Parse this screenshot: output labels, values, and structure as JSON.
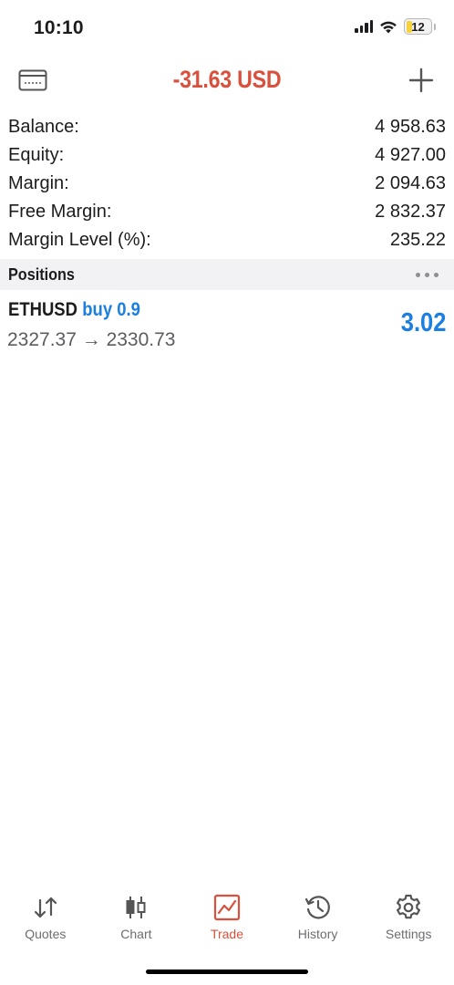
{
  "status_bar": {
    "time": "10:10",
    "battery": "12"
  },
  "header": {
    "title": "-31.63 USD",
    "title_color": "#d9503c",
    "left_icon": "account-card-icon",
    "right_icon": "plus-icon"
  },
  "summary": [
    {
      "label": "Balance:",
      "value": "4 958.63"
    },
    {
      "label": "Equity:",
      "value": "4 927.00"
    },
    {
      "label": "Margin:",
      "value": "2 094.63"
    },
    {
      "label": "Free Margin:",
      "value": "2 832.37"
    },
    {
      "label": "Margin Level (%):",
      "value": "235.22"
    }
  ],
  "positions": {
    "title": "Positions",
    "items": [
      {
        "symbol": "ETHUSD",
        "side": "buy 0.9",
        "prices": "2327.37 → 2330.73",
        "profit": "3.02",
        "profit_color": "#1a7fe0"
      }
    ]
  },
  "tabs": [
    {
      "label": "Quotes",
      "icon": "quotes-arrows-icon",
      "active": false
    },
    {
      "label": "Chart",
      "icon": "candlestick-icon",
      "active": false
    },
    {
      "label": "Trade",
      "icon": "trade-chart-icon",
      "active": true
    },
    {
      "label": "History",
      "icon": "history-clock-icon",
      "active": false
    },
    {
      "label": "Settings",
      "icon": "gear-icon",
      "active": false
    }
  ],
  "colors": {
    "accent_active": "#d9503c",
    "profit": "#1a7fe0",
    "section_bg": "#f2f2f4"
  }
}
